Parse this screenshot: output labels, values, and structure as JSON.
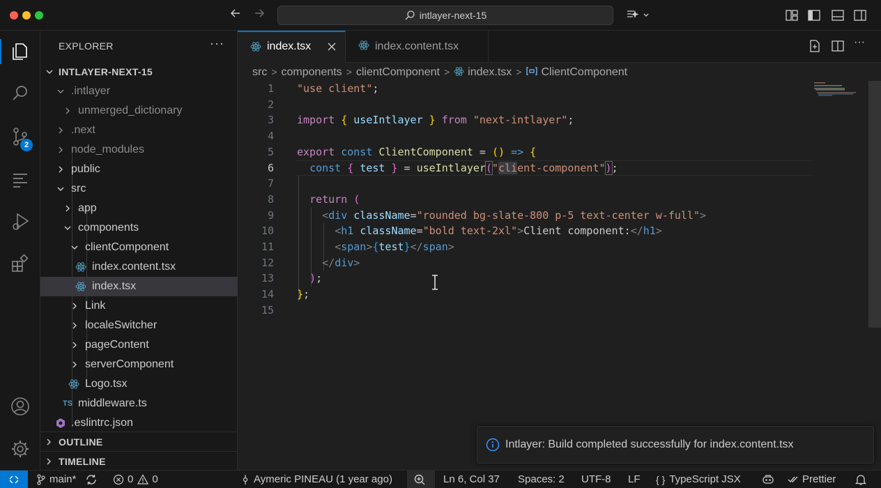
{
  "titlebar": {
    "search_text": "intlayer-next-15",
    "back_icon": "arrow-left-icon",
    "forward_icon": "arrow-right-icon"
  },
  "activity_bar": {
    "items": [
      "explorer",
      "search",
      "source-control",
      "timeline",
      "run-and-debug",
      "extensions"
    ],
    "scm_badge": "2",
    "bottom": [
      "accounts",
      "manage"
    ]
  },
  "explorer": {
    "title": "EXPLORER",
    "more": "···",
    "root": "INTLAYER-NEXT-15",
    "tree": [
      {
        "label": ".intlayer",
        "kind": "folder",
        "open": true,
        "dim": false
      },
      {
        "label": "unmerged_dictionary",
        "kind": "folder",
        "open": false,
        "dim": true
      },
      {
        "label": ".next",
        "kind": "folder",
        "open": false,
        "dim": true
      },
      {
        "label": "node_modules",
        "kind": "folder",
        "open": false,
        "dim": true
      },
      {
        "label": "public",
        "kind": "folder",
        "open": false,
        "dim": false
      },
      {
        "label": "src",
        "kind": "folder",
        "open": true,
        "dim": false
      },
      {
        "label": "app",
        "kind": "folder",
        "open": false,
        "dim": false
      },
      {
        "label": "components",
        "kind": "folder",
        "open": true,
        "dim": false
      },
      {
        "label": "clientComponent",
        "kind": "folder",
        "open": true,
        "dim": false
      },
      {
        "label": "index.content.tsx",
        "kind": "react",
        "dim": false
      },
      {
        "label": "index.tsx",
        "kind": "react",
        "dim": false,
        "selected": true
      },
      {
        "label": "Link",
        "kind": "folder",
        "open": false,
        "dim": false
      },
      {
        "label": "localeSwitcher",
        "kind": "folder",
        "open": false,
        "dim": false
      },
      {
        "label": "pageContent",
        "kind": "folder",
        "open": false,
        "dim": false
      },
      {
        "label": "serverComponent",
        "kind": "folder",
        "open": false,
        "dim": false
      },
      {
        "label": "Logo.tsx",
        "kind": "react",
        "dim": false
      },
      {
        "label": "middleware.ts",
        "kind": "ts",
        "dim": false
      },
      {
        "label": ".eslintrc.json",
        "kind": "eslint",
        "dim": false
      }
    ],
    "ts_badge": "TS",
    "outline": "OUTLINE",
    "timeline": "TIMELINE"
  },
  "tabs": [
    {
      "label": "index.tsx",
      "active": true
    },
    {
      "label": "index.content.tsx",
      "active": false
    }
  ],
  "breadcrumb": [
    "src",
    "components",
    "clientComponent",
    "index.tsx",
    "ClientComponent"
  ],
  "editor": {
    "current_line": 6,
    "line_numbers": [
      "1",
      "2",
      "3",
      "4",
      "5",
      "6",
      "7",
      "8",
      "9",
      "10",
      "11",
      "12",
      "13",
      "14",
      "15"
    ]
  },
  "notification": {
    "message": "Intlayer: Build completed successfully for index.content.tsx"
  },
  "statusbar": {
    "branch": "main*",
    "errors": "0",
    "warnings": "0",
    "blame": "Aymeric PINEAU (1 year ago)",
    "position": "Ln 6, Col 37",
    "spaces": "Spaces: 2",
    "encoding": "UTF-8",
    "eol": "LF",
    "language": "TypeScript JSX",
    "language_braces": "{ }",
    "prettier": "Prettier"
  },
  "colors": {
    "accent": "#0078d4",
    "background": "#1f1f1f",
    "sidebar": "#181818"
  }
}
